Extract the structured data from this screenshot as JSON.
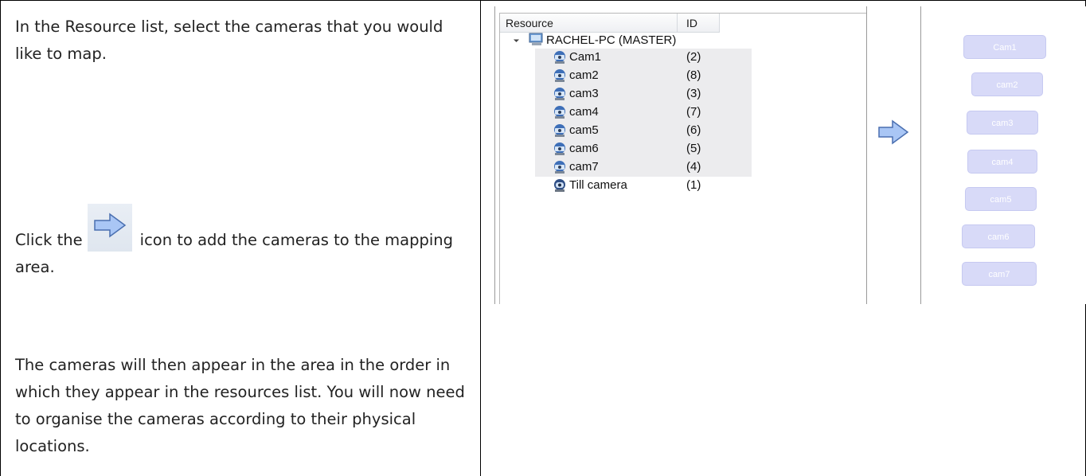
{
  "instructions": {
    "para1": "In the Resource list, select the cameras that you would like to map.",
    "para2_before": "Click the",
    "para2_after": "icon to add the cameras to the mapping area.",
    "para3": "The cameras will then appear in the area in the order in which they appear in the resources list. You will now need to organise the cameras according to their physical locations."
  },
  "tree": {
    "header_resource": "Resource",
    "header_id": "ID",
    "root_label": "RACHEL-PC (MASTER)",
    "items": [
      {
        "label": "Cam1",
        "id": "(2)"
      },
      {
        "label": "cam2",
        "id": "(8)"
      },
      {
        "label": "cam3",
        "id": "(3)"
      },
      {
        "label": "cam4",
        "id": "(7)"
      },
      {
        "label": "cam5",
        "id": "(6)"
      },
      {
        "label": "cam6",
        "id": "(5)"
      },
      {
        "label": "cam7",
        "id": "(4)"
      },
      {
        "label": "Till camera",
        "id": "(1)"
      }
    ]
  },
  "mapping": {
    "buttons": [
      "Cam1",
      "cam2",
      "cam3",
      "cam4",
      "cam5",
      "cam6",
      "cam7"
    ]
  },
  "colors": {
    "arrow_fill": "#a9c6f5",
    "arrow_stroke": "#4a6fb0",
    "map_button": "#d8daf8",
    "row_highlight": "#ececee"
  },
  "icons": {
    "add_arrow": "right-arrow-icon",
    "camera": "camera-icon",
    "computer": "computer-icon"
  }
}
